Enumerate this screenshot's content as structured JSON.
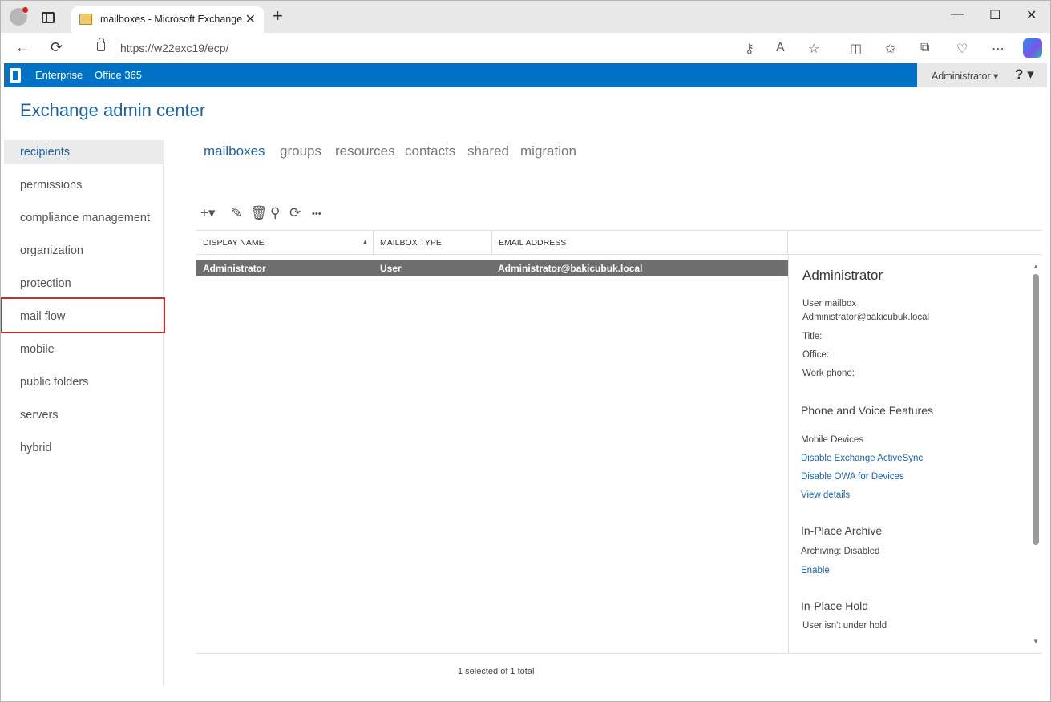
{
  "browser": {
    "tab_title": "mailboxes - Microsoft Exchange",
    "tab_close": "✕",
    "new_tab": "+",
    "url": "https://w22exc19/ecp/",
    "minimize": "—",
    "maximize": "☐",
    "close": "✕"
  },
  "header": {
    "enterprise": "Enterprise",
    "office365": "Office 365",
    "user_menu": "Administrator ▾",
    "help": "? ▾"
  },
  "app_title": "Exchange admin center",
  "nav": {
    "items": [
      {
        "label": "recipients"
      },
      {
        "label": "permissions"
      },
      {
        "label": "compliance management"
      },
      {
        "label": "organization"
      },
      {
        "label": "protection"
      },
      {
        "label": "mail flow"
      },
      {
        "label": "mobile"
      },
      {
        "label": "public folders"
      },
      {
        "label": "servers"
      },
      {
        "label": "hybrid"
      }
    ]
  },
  "subtabs": [
    {
      "label": "mailboxes"
    },
    {
      "label": "groups"
    },
    {
      "label": "resources"
    },
    {
      "label": "contacts"
    },
    {
      "label": "shared"
    },
    {
      "label": "migration"
    }
  ],
  "toolbar": {
    "add": "+▾",
    "edit": "✎",
    "delete": "🗑",
    "search": "⚲",
    "refresh": "⟳",
    "more": "•••"
  },
  "grid": {
    "columns": [
      "DISPLAY NAME",
      "MAILBOX TYPE",
      "EMAIL ADDRESS"
    ],
    "sort_indicator": "▲",
    "rows": [
      {
        "display_name": "Administrator",
        "mailbox_type": "User",
        "email": "Administrator@bakicubuk.local"
      }
    ],
    "status": "1 selected of 1 total"
  },
  "details": {
    "title": "Administrator",
    "mailbox_type": "User mailbox",
    "email": "Administrator@bakicubuk.local",
    "title_label": "Title:",
    "office_label": "Office:",
    "work_phone_label": "Work phone:",
    "phone_voice_head": "Phone and Voice Features",
    "mobile_devices": "Mobile Devices",
    "disable_eas": "Disable Exchange ActiveSync",
    "disable_owa": "Disable OWA for Devices",
    "view_details": "View details",
    "archive_head": "In-Place Archive",
    "archiving": "Archiving:  Disabled",
    "enable": "Enable",
    "hold_head": "In-Place Hold",
    "hold_status": "User isn't under hold"
  },
  "scroll": {
    "up": "▲",
    "down": "▼"
  }
}
